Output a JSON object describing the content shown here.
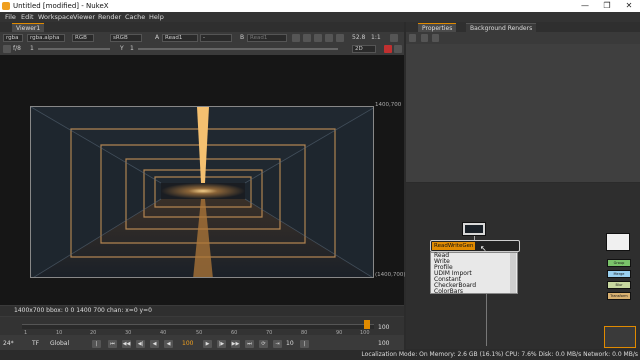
{
  "window": {
    "title": "Untitled [modified] - NukeX",
    "minimize": "—",
    "maximize": "❐",
    "close": "✕"
  },
  "menu": [
    "File",
    "Edit",
    "Workspace",
    "Viewer",
    "Render",
    "Cache",
    "Help"
  ],
  "viewer": {
    "tab_label": "Viewer1",
    "channels": "rgba",
    "alpha_channel": "rgba.alpha",
    "colorspace_label": "RGB",
    "lut": "sRGB",
    "input_a_label": "A",
    "input_a_value": "Read1",
    "input_b_label": "B",
    "input_b_value": "Read1",
    "wipe_value": "-",
    "zoom": "52.8",
    "proxy_ratio": "1:1",
    "view_mode": "2D",
    "fstop": "f/8",
    "gain_value": "1",
    "gamma_label": "Y",
    "gamma_value": "1",
    "frame_label_tl": "",
    "frame_label_tr": "1400,700",
    "frame_label_br": "(1400,700)",
    "status_text": "1400x700  bbox: 0 0 1400 700  chan: x=0 y=0"
  },
  "timeline": {
    "ticks": [
      "1",
      "10",
      "20",
      "30",
      "40",
      "50",
      "60",
      "70",
      "80",
      "90",
      "100"
    ],
    "playhead_frame": "100",
    "end_frame": "100",
    "progress": 0.98
  },
  "playback": {
    "fps": "24*",
    "tf": "TF",
    "scope": "Global",
    "current_frame": "100",
    "increment": "10",
    "out_frame": "100"
  },
  "properties": {
    "tab_properties": "Properties",
    "tab_background_renders": "Background Renders"
  },
  "nodegraph": {
    "search_value": "ReadWriteGen",
    "suggestions": [
      "Read",
      "Write",
      "Profile",
      "UDIM Import",
      "Constant",
      "CheckerBoard",
      "ColorBars"
    ],
    "side_nodes": [
      {
        "label": "",
        "color": "#f0f0f0"
      },
      {
        "label": "Group",
        "color": "#7ac26a"
      },
      {
        "label": "Merge",
        "color": "#9ad0f0"
      },
      {
        "label": "Blur",
        "color": "#c8d8a0"
      },
      {
        "label": "Transform",
        "color": "#d8b070"
      }
    ]
  },
  "status_bar": "Localization Mode: On  Memory: 2.6 GB (16.1%)  CPU: 7.6%  Disk: 0.0 MB/s  Network: 0.0 MB/s",
  "colors": {
    "accent": "#e08a00",
    "panel": "#3a3a3a",
    "viewport": "#161616"
  }
}
